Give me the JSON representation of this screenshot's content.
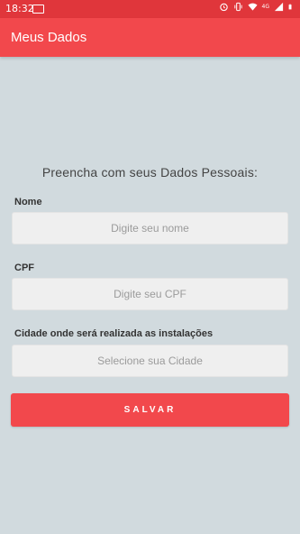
{
  "status_bar": {
    "time": "18:32",
    "network": "4G"
  },
  "app_bar": {
    "title": "Meus Dados"
  },
  "form": {
    "heading": "Preencha com seus Dados Pessoais:",
    "fields": [
      {
        "label": "Nome",
        "placeholder": "Digite seu nome"
      },
      {
        "label": "CPF",
        "placeholder": "Digite seu CPF"
      },
      {
        "label": "Cidade onde será realizada as instalações",
        "placeholder": "Selecione sua Cidade"
      }
    ],
    "save_label": "SALVAR"
  }
}
